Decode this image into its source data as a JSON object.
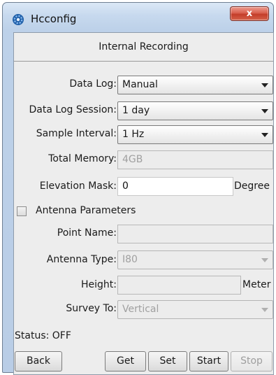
{
  "window": {
    "title": "Hcconfig",
    "close_label": "x"
  },
  "section": {
    "title": "Internal Recording"
  },
  "fields": {
    "data_log": {
      "label": "Data Log:",
      "value": "Manual"
    },
    "data_log_session": {
      "label": "Data Log Session:",
      "value": "1 day"
    },
    "sample_interval": {
      "label": "Sample Interval:",
      "value": "1 Hz"
    },
    "total_memory": {
      "label": "Total Memory:",
      "value": "4GB"
    },
    "elevation_mask": {
      "label": "Elevation Mask:",
      "value": "0",
      "unit": "Degree"
    },
    "antenna_parameters": {
      "label": "Antenna Parameters",
      "checked": false
    },
    "point_name": {
      "label": "Point Name:",
      "value": ""
    },
    "antenna_type": {
      "label": "Antenna Type:",
      "value": "I80"
    },
    "height": {
      "label": "Height:",
      "value": "",
      "unit": "Meter"
    },
    "survey_to": {
      "label": "Survey To:",
      "value": "Vertical"
    }
  },
  "status": {
    "text": "Status: OFF"
  },
  "buttons": {
    "back": "Back",
    "get": "Get",
    "set": "Set",
    "start": "Start",
    "stop": "Stop"
  },
  "colors": {
    "frame": "#bdd1e9",
    "close": "#c8412e",
    "panel": "#ededed"
  }
}
